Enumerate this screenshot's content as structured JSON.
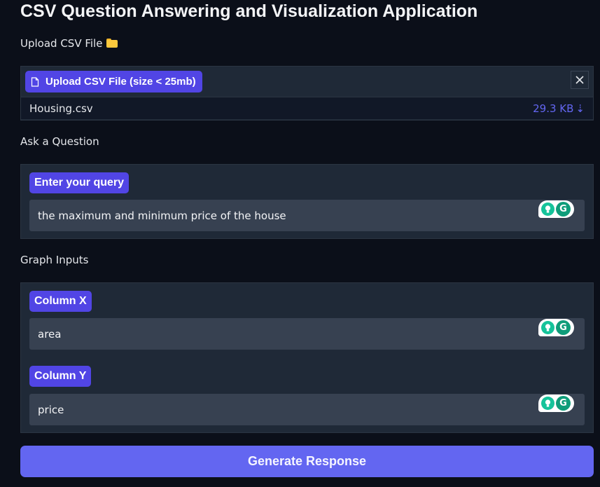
{
  "app": {
    "title": "CSV Question Answering and Visualization Application"
  },
  "upload": {
    "section_label": "Upload CSV File",
    "section_icon": "folder-icon",
    "button_label": "Upload CSV File (size < 25mb)",
    "file_name": "Housing.csv",
    "file_size": "29.3 KB",
    "download_glyph": "⇣"
  },
  "question": {
    "section_label": "Ask a Question",
    "field_label": "Enter your query",
    "value": "the maximum and minimum price of the house"
  },
  "graph": {
    "section_label": "Graph Inputs",
    "x_label": "Column X",
    "x_value": "area",
    "y_label": "Column Y",
    "y_value": "price"
  },
  "actions": {
    "generate_label": "Generate Response"
  },
  "colors": {
    "background": "#0b0f19",
    "panel": "#1f2937",
    "field": "#374151",
    "accent": "#5145e5",
    "button": "#6366f1",
    "grammarly": "#15c39a"
  }
}
